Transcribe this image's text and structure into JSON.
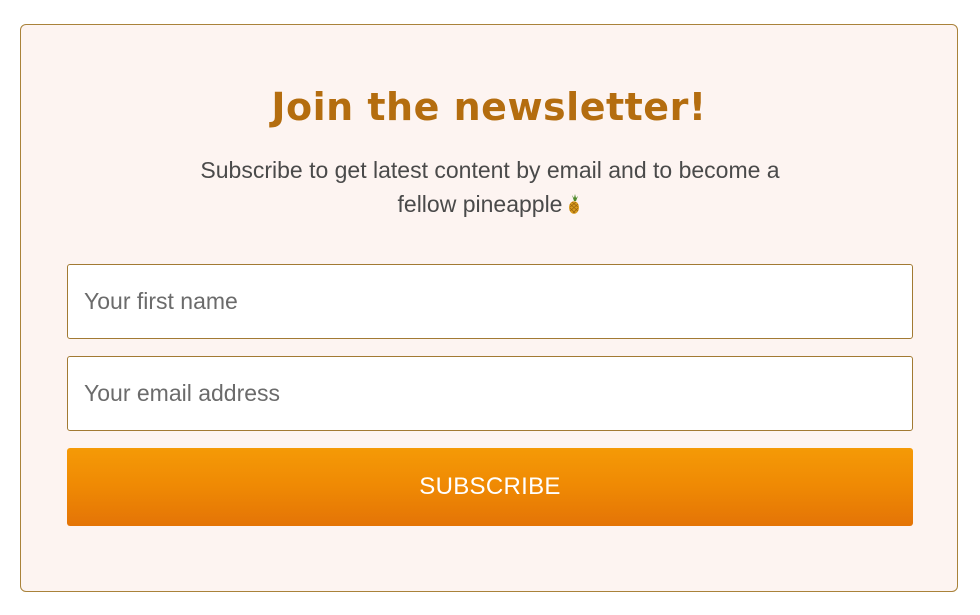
{
  "newsletter": {
    "title": "Join the newsletter!",
    "subtitle_text": "Subscribe to get latest content by email and to become a fellow pineapple",
    "subtitle_icon": "pineapple-icon",
    "first_name_placeholder": "Your first name",
    "email_placeholder": "Your email address",
    "subscribe_label": "SUBSCRIBE"
  },
  "colors": {
    "card_background": "#fdf4f1",
    "card_border": "#a9823a",
    "title": "#b46d0f",
    "button_top": "#f59a06",
    "button_bottom": "#e47406",
    "text": "#4a4a4a"
  }
}
